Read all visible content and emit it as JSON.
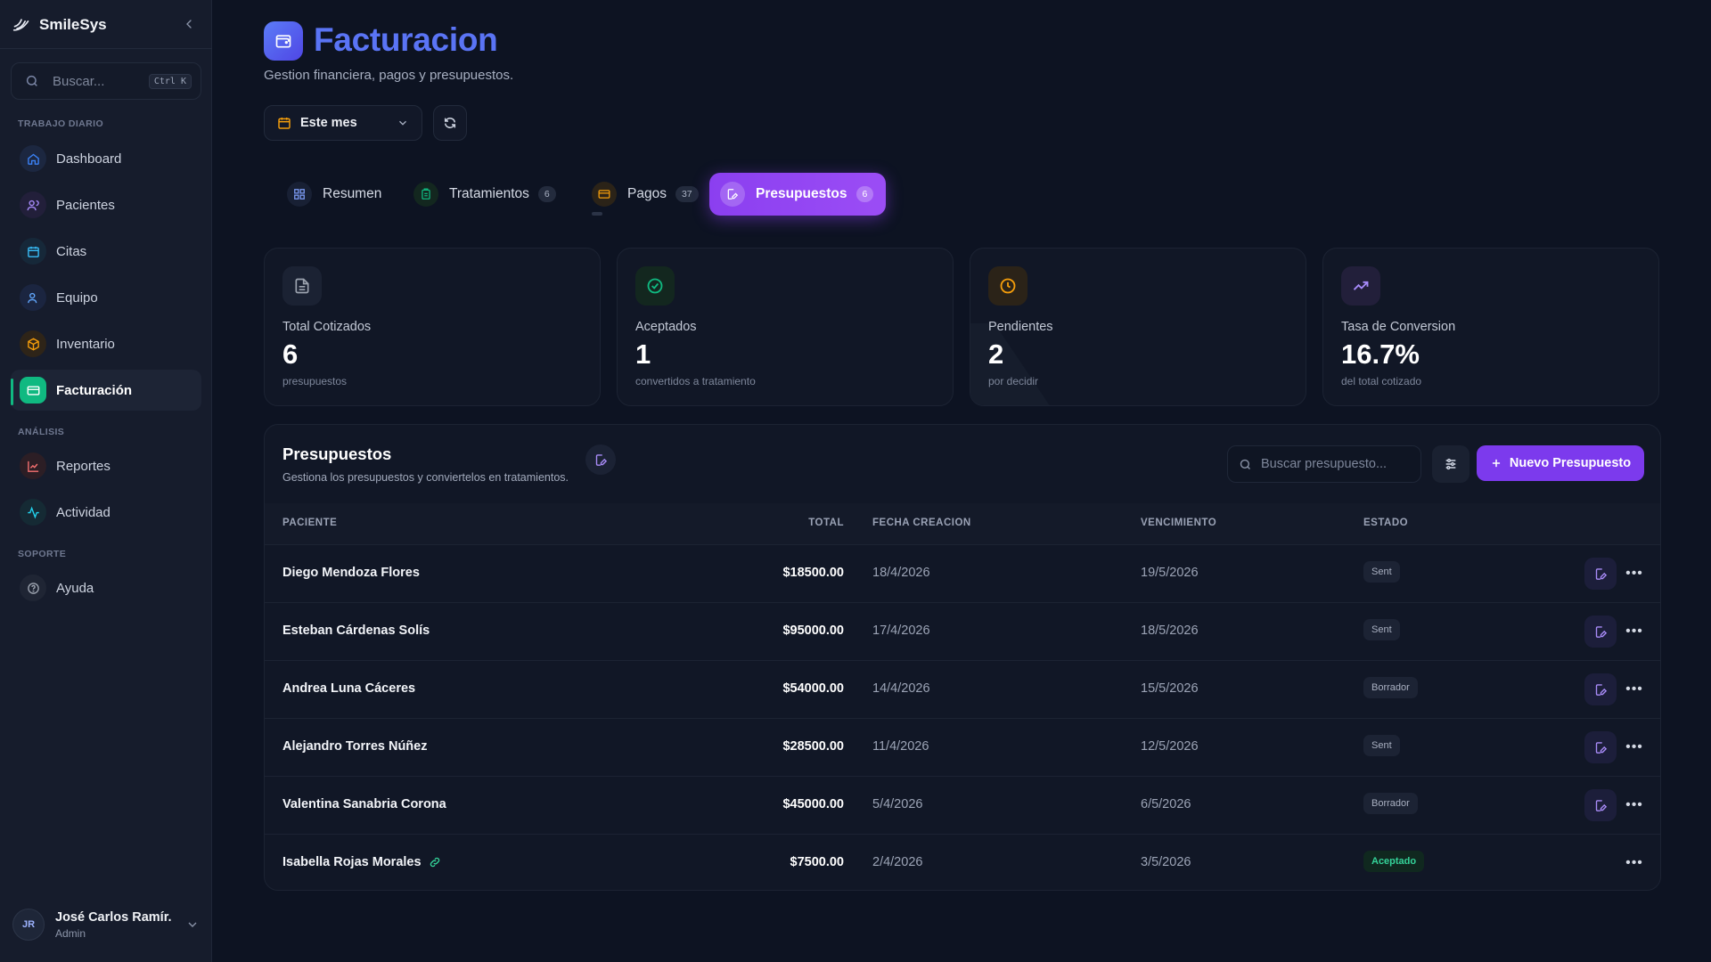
{
  "app": {
    "name": "SmileSys"
  },
  "sidebar": {
    "search": {
      "placeholder": "Buscar...",
      "shortcut": "Ctrl K"
    },
    "sections": {
      "daily": "TRABAJO DIARIO",
      "analysis": "ANÁLISIS",
      "support": "SOPORTE"
    },
    "items": [
      {
        "label": "Dashboard",
        "icon": "home-icon",
        "color": "#3b82f6"
      },
      {
        "label": "Pacientes",
        "icon": "users-icon",
        "color": "#a78bfa"
      },
      {
        "label": "Citas",
        "icon": "calendar-icon",
        "color": "#38bdf8"
      },
      {
        "label": "Equipo",
        "icon": "user-group-icon",
        "color": "#60a5fa"
      },
      {
        "label": "Inventario",
        "icon": "package-icon",
        "color": "#f59e0b"
      },
      {
        "label": "Facturación",
        "icon": "credit-card-icon",
        "color": "#10b981"
      },
      {
        "label": "Reportes",
        "icon": "chart-line-icon",
        "color": "#f87171"
      },
      {
        "label": "Actividad",
        "icon": "activity-icon",
        "color": "#22d3ee"
      },
      {
        "label": "Ayuda",
        "icon": "help-circle-icon",
        "color": "#9ca3af"
      }
    ],
    "user": {
      "initials": "JR",
      "name": "José Carlos Ramír...",
      "role": "Admin"
    }
  },
  "header": {
    "title": "Facturacion",
    "subtitle": "Gestion financiera, pagos y presupuestos.",
    "period": "Este mes"
  },
  "tabs": [
    {
      "label": "Resumen",
      "count": null
    },
    {
      "label": "Tratamientos",
      "count": "6"
    },
    {
      "label": "Pagos",
      "count": "37"
    },
    {
      "label": "Presupuestos",
      "count": "6",
      "active": true
    }
  ],
  "stats": [
    {
      "label": "Total Cotizados",
      "value": "6",
      "sub": "presupuestos",
      "icon": "document-icon",
      "color": "#9ca3af"
    },
    {
      "label": "Aceptados",
      "value": "1",
      "sub": "convertidos a tratamiento",
      "icon": "check-circle-icon",
      "color": "#10b981"
    },
    {
      "label": "Pendientes",
      "value": "2",
      "sub": "por decidir",
      "icon": "clock-icon",
      "color": "#f59e0b"
    },
    {
      "label": "Tasa de Conversion",
      "value": "16.7%",
      "sub": "del total cotizado",
      "icon": "trending-up-icon",
      "color": "#a78bfa"
    }
  ],
  "budgets": {
    "title": "Presupuestos",
    "subtitle": "Gestiona los presupuestos y conviertelos en tratamientos.",
    "search_placeholder": "Buscar presupuesto...",
    "new_button": "Nuevo Presupuesto",
    "columns": [
      "PACIENTE",
      "TOTAL",
      "FECHA CREACION",
      "VENCIMIENTO",
      "ESTADO"
    ],
    "rows": [
      {
        "patient": "Diego Mendoza Flores",
        "total": "$18500.00",
        "created": "18/4/2026",
        "due": "19/5/2026",
        "status": "Sent"
      },
      {
        "patient": "Esteban Cárdenas Solís",
        "total": "$95000.00",
        "created": "17/4/2026",
        "due": "18/5/2026",
        "status": "Sent"
      },
      {
        "patient": "Andrea Luna Cáceres",
        "total": "$54000.00",
        "created": "14/4/2026",
        "due": "15/5/2026",
        "status": "Borrador"
      },
      {
        "patient": "Alejandro Torres Núñez",
        "total": "$28500.00",
        "created": "11/4/2026",
        "due": "12/5/2026",
        "status": "Sent"
      },
      {
        "patient": "Valentina Sanabria Corona",
        "total": "$45000.00",
        "created": "5/4/2026",
        "due": "6/5/2026",
        "status": "Borrador"
      },
      {
        "patient": "Isabella Rojas Morales",
        "total": "$7500.00",
        "created": "2/4/2026",
        "due": "3/5/2026",
        "status": "Aceptado"
      }
    ]
  }
}
